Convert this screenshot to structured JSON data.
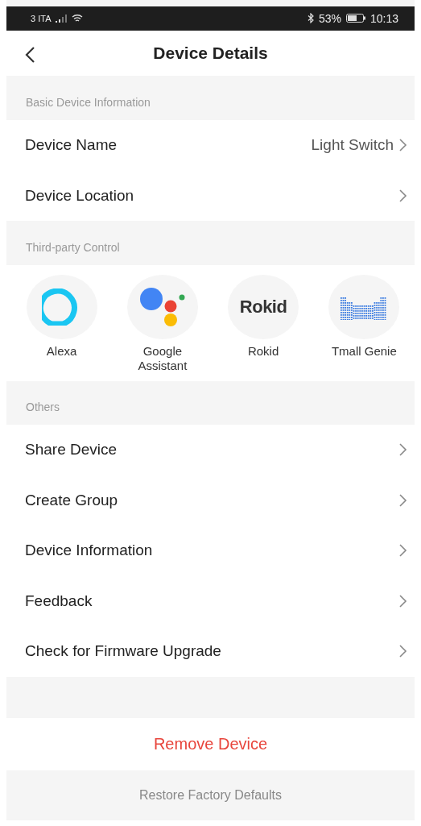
{
  "status_bar": {
    "carrier": "3 ITA",
    "battery": "53%",
    "time": "10:13"
  },
  "header": {
    "title": "Device Details"
  },
  "sections": [
    {
      "title": "Basic Device Information",
      "kind": "rows",
      "rows": [
        {
          "label": "Device Name",
          "value": "Light Switch"
        },
        {
          "label": "Device Location"
        }
      ]
    },
    {
      "title": "Third-party Control",
      "kind": "integrations",
      "integrations": [
        {
          "kind": "alexa",
          "label": "Alexa"
        },
        {
          "kind": "google",
          "label": "Google Assistant"
        },
        {
          "kind": "wordmark",
          "logo_text": "Rokid",
          "label": "Rokid"
        },
        {
          "kind": "bars",
          "label": "Tmall Genie"
        }
      ]
    },
    {
      "title": "Others",
      "kind": "rows",
      "rows": [
        {
          "label": "Share Device"
        },
        {
          "label": "Create Group"
        },
        {
          "label": "Device Information"
        },
        {
          "label": "Feedback"
        },
        {
          "label": "Check for Firmware Upgrade"
        }
      ]
    }
  ],
  "remove_button": "Remove Device",
  "restore_button": "Restore Factory Defaults"
}
